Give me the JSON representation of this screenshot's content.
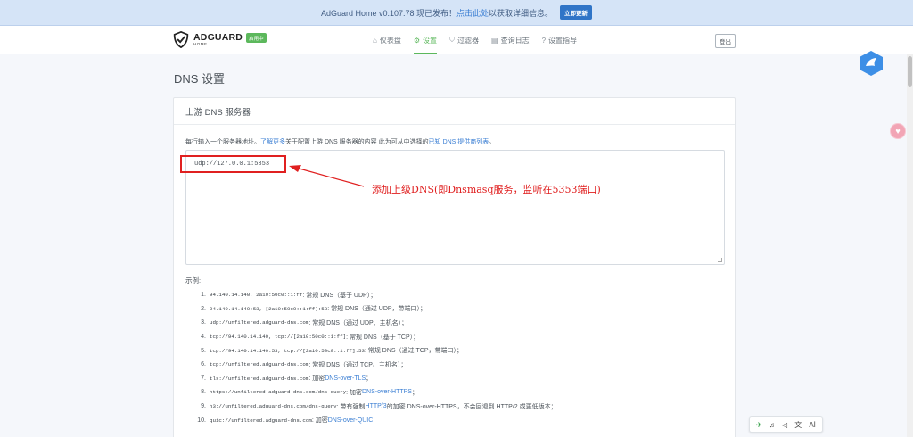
{
  "banner": {
    "prefix": "AdGuard Home v0.107.78 现已发布！",
    "link": "点击此处",
    "suffix": "以获取详细信息。",
    "button": "立即更新"
  },
  "header": {
    "logo_title": "ADGUARD",
    "logo_sub": "HOME",
    "status_badge": "启用中",
    "nav": [
      {
        "icon": "⌂",
        "label": "仪表盘"
      },
      {
        "icon": "⚙",
        "label": "设置"
      },
      {
        "icon": "⛉",
        "label": "过滤器"
      },
      {
        "icon": "▤",
        "label": "查询日志"
      },
      {
        "icon": "?",
        "label": "设置指导"
      }
    ],
    "logout": "登出"
  },
  "page": {
    "title": "DNS 设置"
  },
  "card": {
    "title": "上游 DNS 服务器",
    "desc_1": "每行输入一个服务器地址。",
    "desc_link_1": "了解更多",
    "desc_2": "关于配置上游 DNS 服务器的内容 此为可从中选择的",
    "desc_link_2": "已知 DNS 提供商列表",
    "desc_3": "。",
    "textarea_value": "udp://127.0.0.1:5353",
    "examples_label": "示例:"
  },
  "annotation": {
    "text": "添加上级DNS(即Dnsmasq服务，监听在5353端口)",
    "color": "#e02020"
  },
  "examples": [
    {
      "num": "1.",
      "code": "94.140.14.140, 2a10:50c0::1:ff",
      "text": ": 常规 DNS（基于 UDP）；",
      "link": "",
      "after": ""
    },
    {
      "num": "2.",
      "code": "94.140.14.140:53, [2a10:50c0::1:ff]:53",
      "text": ": 常规 DNS（通过 UDP，带端口）；",
      "link": "",
      "after": ""
    },
    {
      "num": "3.",
      "code": "udp://unfiltered.adguard-dns.com",
      "text": ": 常规 DNS（通过 UDP、主机名）；",
      "link": "",
      "after": ""
    },
    {
      "num": "4.",
      "code": "tcp://94.140.14.140, tcp://[2a10:50c0::1:ff]",
      "text": ": 常规 DNS（基于 TCP）；",
      "link": "",
      "after": ""
    },
    {
      "num": "5.",
      "code": "tcp://94.140.14.140:53, tcp://[2a10:50c0::1:ff]:53",
      "text": ": 常规 DNS（通过 TCP，带端口）；",
      "link": "",
      "after": ""
    },
    {
      "num": "6.",
      "code": "tcp://unfiltered.adguard-dns.com",
      "text": ": 常规 DNS（通过 TCP、主机名）；",
      "link": "",
      "after": ""
    },
    {
      "num": "7.",
      "code": "tls://unfiltered.adguard-dns.com",
      "text": ": 加密 ",
      "link": "DNS-over-TLS",
      "after": "；"
    },
    {
      "num": "8.",
      "code": "https://unfiltered.adguard-dns.com/dns-query",
      "text": ": 加密 ",
      "link": "DNS-over-HTTPS",
      "after": "；"
    },
    {
      "num": "9.",
      "code": "h3://unfiltered.adguard-dns.com/dns-query",
      "text": ": 带有强制 ",
      "link": "HTTP/3",
      "after": " 的加密 DNS-over-HTTPS，不会回退到 HTTP/2 或更低版本；"
    },
    {
      "num": "10.",
      "code": "quic://unfiltered.adguard-dns.com",
      "text": ": 加密 ",
      "link": "DNS-over-QUIC",
      "after": ""
    }
  ],
  "toolbar": {
    "items": [
      "✈",
      "♫",
      "◁",
      "文",
      "Aİ"
    ]
  }
}
